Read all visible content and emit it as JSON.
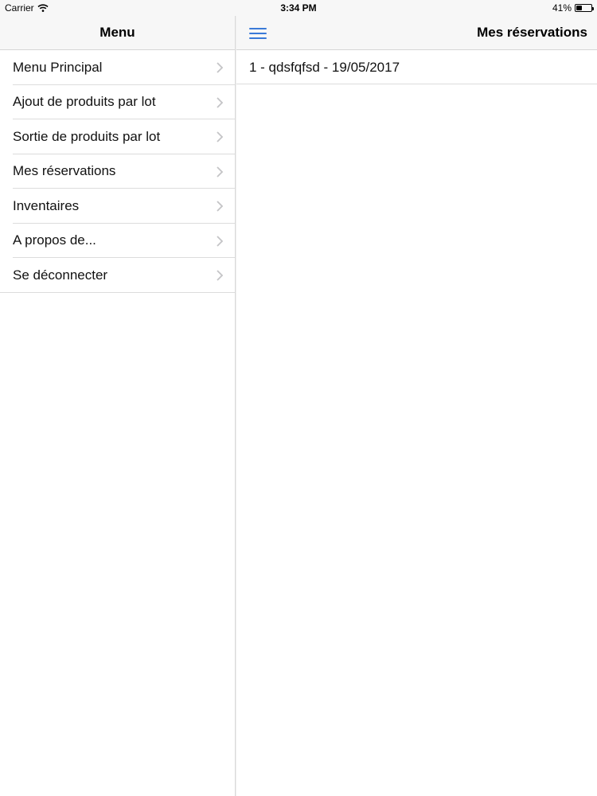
{
  "status": {
    "carrier": "Carrier",
    "time": "3:34 PM",
    "battery": "41%",
    "battery_level": 0.41
  },
  "sidebar": {
    "title": "Menu",
    "items": [
      {
        "label": "Menu Principal"
      },
      {
        "label": "Ajout de produits par lot"
      },
      {
        "label": "Sortie de produits par lot"
      },
      {
        "label": "Mes réservations"
      },
      {
        "label": "Inventaires"
      },
      {
        "label": "A propos de..."
      },
      {
        "label": "Se déconnecter"
      }
    ]
  },
  "main": {
    "title": "Mes réservations",
    "reservations": [
      {
        "label": "1 - qdsfqfsd - 19/05/2017"
      }
    ]
  },
  "colors": {
    "accent": "#3a7ad8",
    "nav_background": "#f7f7f7",
    "separator": "#dcdcdc"
  },
  "icons": {
    "wifi": "wifi-icon",
    "battery": "battery-icon",
    "chevron": "chevron-right-icon",
    "menu": "hamburger-menu-icon"
  }
}
